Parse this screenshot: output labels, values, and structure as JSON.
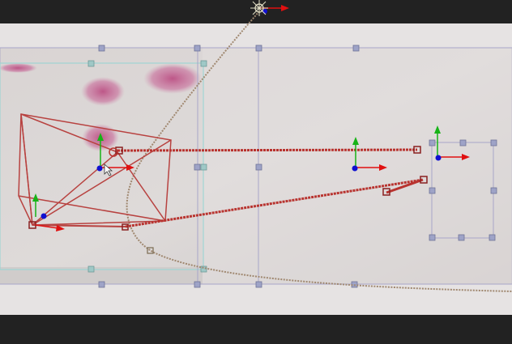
{
  "app": {
    "view": "viewer-viewport",
    "editor_mode": "motion-path-edit"
  },
  "colors": {
    "letterbox": "#222222",
    "stage": "#e6e3e3",
    "backdrop_paper": "#d6d2d1",
    "frame_outline": "#a8a6c9",
    "selection_outline": "#9fd4d3",
    "motion_path": "#b8332f",
    "spline_path": "#a08870",
    "axis_x": "#e01010",
    "axis_y": "#17b317",
    "axis_z": "#1010d0",
    "handle_fill": "#9ea3c7",
    "stain": "#c2548a"
  },
  "icons": {
    "gizmo": "transform-gizmo-icon",
    "handle": "resize-handle-icon",
    "keyframe": "keyframe-marker-icon",
    "light": "point-light-icon"
  },
  "scene": {
    "layers": [
      "paper-backdrop-layer",
      "selected-image-layer",
      "center-card-layer",
      "small-card-layer",
      "large-frame-layer"
    ],
    "gizmos": [
      "gizmo-wireframe-camera",
      "gizmo-camera-near",
      "gizmo-center-card",
      "gizmo-small-card",
      "gizmo-top-light"
    ],
    "keyframes": 6
  }
}
